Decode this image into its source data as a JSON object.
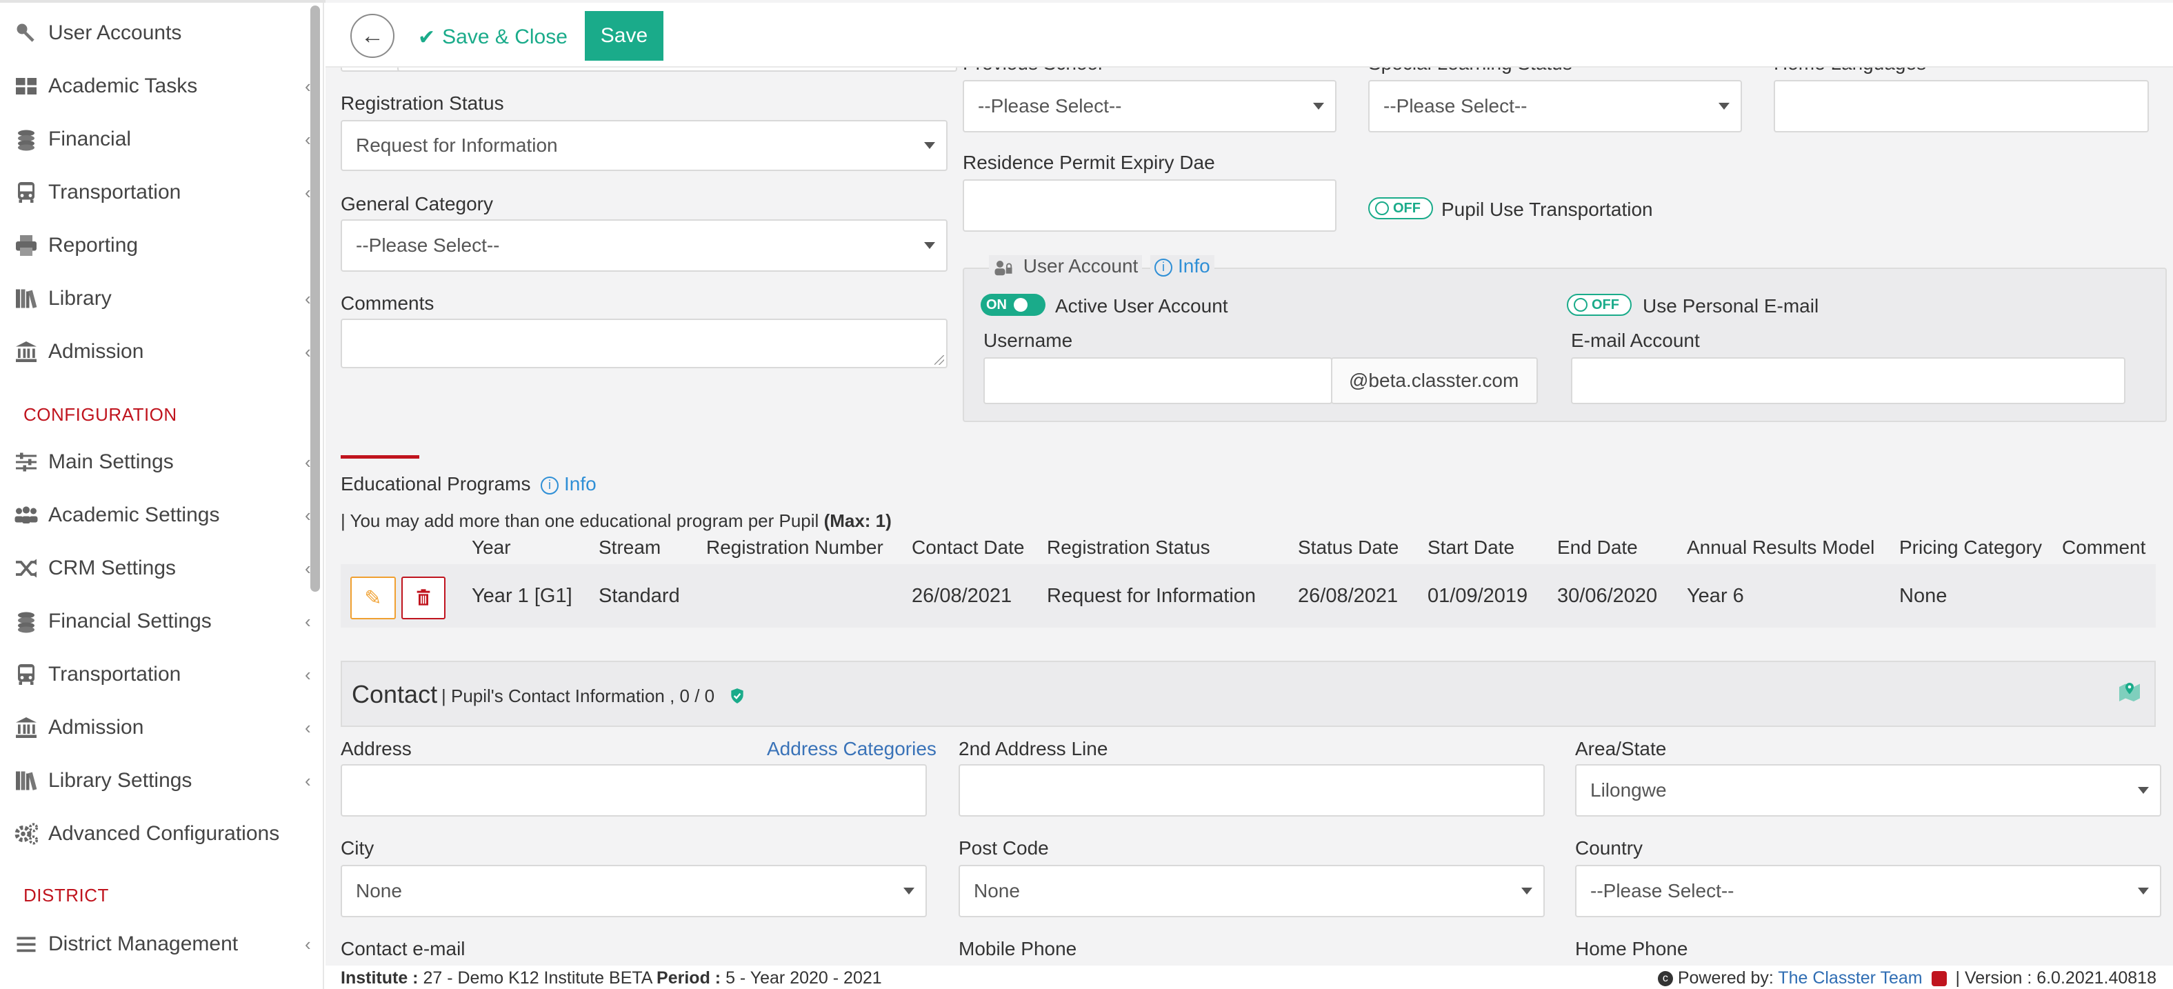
{
  "sidebar": {
    "items": [
      {
        "label": "User Accounts",
        "icon": "key-icon",
        "chevron": false
      },
      {
        "label": "Academic Tasks",
        "icon": "dashboard-grid-icon",
        "chevron": true
      },
      {
        "label": "Financial",
        "icon": "coins-icon",
        "chevron": true
      },
      {
        "label": "Transportation",
        "icon": "bus-icon",
        "chevron": true
      },
      {
        "label": "Reporting",
        "icon": "printer-icon",
        "chevron": false
      },
      {
        "label": "Library",
        "icon": "books-icon",
        "chevron": true
      },
      {
        "label": "Admission",
        "icon": "institution-icon",
        "chevron": true
      }
    ],
    "configuration_title": "CONFIGURATION",
    "config_items": [
      {
        "label": "Main Settings",
        "icon": "sliders-icon",
        "chevron": true
      },
      {
        "label": "Academic Settings",
        "icon": "users-icon",
        "chevron": true
      },
      {
        "label": "CRM Settings",
        "icon": "shuffle-icon",
        "chevron": true
      },
      {
        "label": "Financial Settings",
        "icon": "coins-icon",
        "chevron": true
      },
      {
        "label": "Transportation",
        "icon": "bus-icon",
        "chevron": true
      },
      {
        "label": "Admission",
        "icon": "institution-icon",
        "chevron": true
      },
      {
        "label": "Library Settings",
        "icon": "books-icon",
        "chevron": true
      },
      {
        "label": "Advanced Configurations",
        "icon": "gears-icon",
        "chevron": false
      }
    ],
    "district_title": "DISTRICT",
    "district_items": [
      {
        "label": "District Management",
        "icon": "menu-lines-icon",
        "chevron": true
      }
    ]
  },
  "toolbar": {
    "save_close_label": "Save & Close",
    "save_label": "Save"
  },
  "form": {
    "previous_school_label": "Previous School",
    "previous_school_value": "--Please Select--",
    "special_learning_label": "Special Learning Status",
    "special_learning_value": "--Please Select--",
    "home_languages_label": "Home Languages",
    "registration_status_label": "Registration Status",
    "registration_status_value": "Request for Information",
    "residence_permit_label": "Residence Permit Expiry Dae",
    "pupil_transport_toggle": "OFF",
    "pupil_transport_label": "Pupil Use Transportation",
    "general_category_label": "General Category",
    "general_category_value": "--Please Select--",
    "comments_label": "Comments"
  },
  "user_account": {
    "title": "User Account",
    "info_label": "Info",
    "active_toggle": "ON",
    "active_label": "Active User Account",
    "personal_email_toggle": "OFF",
    "personal_email_label": "Use Personal E-mail",
    "username_label": "Username",
    "domain_suffix": "@beta.classter.com",
    "email_label": "E-mail Account"
  },
  "programs": {
    "title": "Educational Programs",
    "info_label": "Info",
    "note": "| You may add more than one educational program per Pupil",
    "max_note": "(Max: 1)",
    "columns": [
      "Year",
      "Stream",
      "Registration Number",
      "Contact Date",
      "Registration Status",
      "Status Date",
      "Start Date",
      "End Date",
      "Annual Results Model",
      "Pricing Category",
      "Comment"
    ],
    "rows": [
      [
        "Year 1 [G1]",
        "Standard",
        "",
        "26/08/2021",
        "Request for Information",
        "26/08/2021",
        "01/09/2019",
        "30/06/2020",
        "Year 6",
        "None",
        ""
      ]
    ]
  },
  "contact": {
    "title": "Contact",
    "subtitle": "| Pupil's Contact Information , 0 / 0",
    "address_label": "Address",
    "address_categories_link": "Address Categories",
    "address2_label": "2nd Address Line",
    "area_label": "Area/State",
    "area_value": "Lilongwe",
    "city_label": "City",
    "city_value": "None",
    "postcode_label": "Post Code",
    "postcode_value": "None",
    "country_label": "Country",
    "country_value": "--Please Select--",
    "contact_email_label": "Contact e-mail",
    "mobile_label": "Mobile Phone",
    "home_phone_label": "Home Phone"
  },
  "footer": {
    "institute_label": "Institute :",
    "institute_value": "27 - Demo K12 Institute BETA",
    "period_label": "Period :",
    "period_value": "5 - Year 2020 - 2021",
    "powered_by": "Powered by:",
    "team_link": "The Classter Team",
    "version": "| Version : 6.0.2021.40818"
  },
  "colors": {
    "accent": "#1aab8a",
    "danger": "#c0141e",
    "warning": "#f0a030",
    "link": "#2f8fd6"
  }
}
